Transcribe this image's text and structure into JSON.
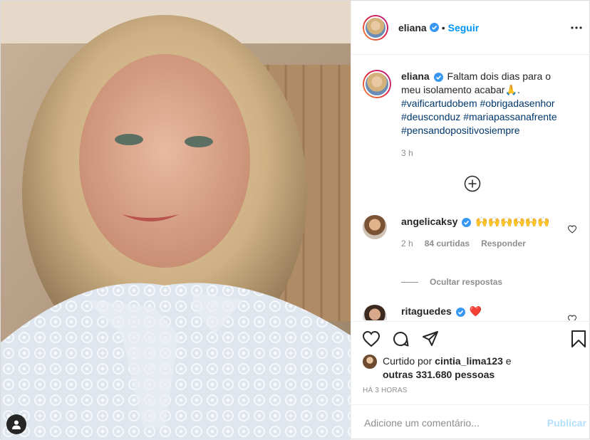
{
  "post": {
    "author": "eliana",
    "follow_label": "Seguir",
    "dot": "•",
    "caption": {
      "text": "Faltam dois dias para o meu isolamento acabar🙏.",
      "hashtags": [
        "#vaificartudobem",
        "#obrigadasenhor",
        "#deusconduz",
        "#mariapassanafrente",
        "#pensandopositivosiempre"
      ],
      "time": "3 h"
    },
    "comments": [
      {
        "username": "angelicaksy",
        "text": "🙌🙌🙌🙌🙌🙌",
        "time": "2 h",
        "likes": "84 curtidas",
        "reply_label": "Responder"
      },
      {
        "username": "ritaguedes",
        "text": "❤️"
      }
    ],
    "hide_replies_label": "Ocultar respostas",
    "liked_by": {
      "prefix": "Curtido por",
      "user": "cintia_lima123",
      "connector": "e",
      "others": "outras 331.680 pessoas"
    },
    "date": "HÁ 3 HORAS",
    "comment_placeholder": "Adicione um comentário...",
    "publish_label": "Publicar"
  },
  "colors": {
    "link_blue": "#0095f6",
    "hashtag_blue": "#00376b",
    "verified_blue": "#3897f0",
    "muted": "#8e8e8e",
    "heart_red": "#ed4956"
  }
}
